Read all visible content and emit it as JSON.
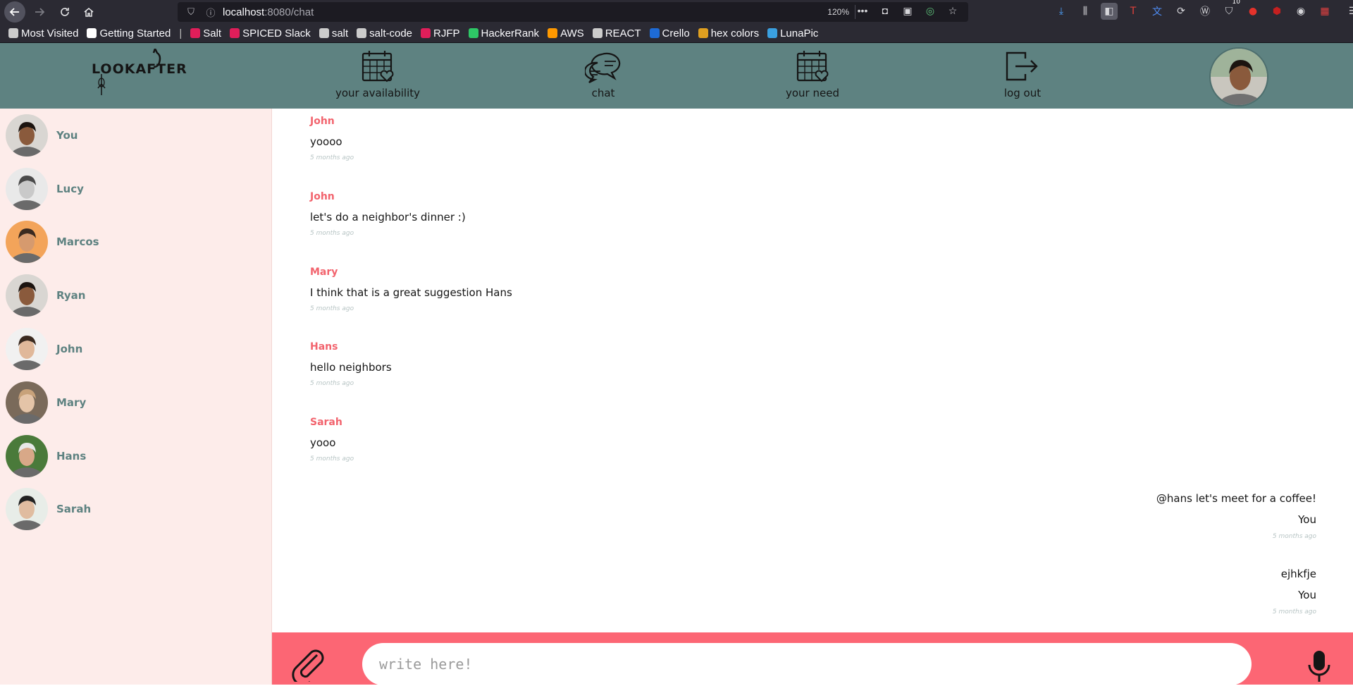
{
  "browser": {
    "url_host": "localhost",
    "url_path": ":8080/chat",
    "zoom": "120%",
    "extension_badge": "10"
  },
  "bookmarks": [
    {
      "label": "Most Visited",
      "icon": "gear-icon",
      "color": "#cccccc"
    },
    {
      "label": "Getting Started",
      "icon": "m-icon",
      "color": "#ffffff"
    },
    {
      "label": "Salt",
      "icon": "slack-icon",
      "color": "#e01e5a"
    },
    {
      "label": "SPICED Slack",
      "icon": "slack-icon",
      "color": "#e01e5a"
    },
    {
      "label": "salt",
      "icon": "github-icon",
      "color": "#cccccc"
    },
    {
      "label": "salt-code",
      "icon": "github-icon",
      "color": "#cccccc"
    },
    {
      "label": "RJFP",
      "icon": "slack-icon",
      "color": "#e01e5a"
    },
    {
      "label": "HackerRank",
      "icon": "hackerrank-icon",
      "color": "#2ec866"
    },
    {
      "label": "AWS",
      "icon": "aws-icon",
      "color": "#ff9900"
    },
    {
      "label": "REACT",
      "icon": "folder-icon",
      "color": "#cccccc"
    },
    {
      "label": "Crello",
      "icon": "crello-icon",
      "color": "#1e6bd6"
    },
    {
      "label": "hex colors",
      "icon": "color-wheel-icon",
      "color": "#e0a020"
    },
    {
      "label": "LunaPic",
      "icon": "lunapic-icon",
      "color": "#3aa0e0"
    }
  ],
  "header": {
    "logo_text": "LOOKAFTER",
    "nav": [
      {
        "label": "your availability",
        "icon": "calendar-heart-icon"
      },
      {
        "label": "chat",
        "icon": "chat-bubbles-icon"
      },
      {
        "label": "your need",
        "icon": "calendar-heart-icon"
      },
      {
        "label": "log out",
        "icon": "logout-icon"
      }
    ]
  },
  "contacts": [
    {
      "name": "You",
      "skin": "#8a5a3c",
      "hair": "#1c1410",
      "bg": "#d9d6d2"
    },
    {
      "name": "Lucy",
      "skin": "#c9c9c9",
      "hair": "#4a4a4a",
      "bg": "#e9e9e9"
    },
    {
      "name": "Marcos",
      "skin": "#d69a6e",
      "hair": "#3a2a20",
      "bg": "#f3a45a"
    },
    {
      "name": "Ryan",
      "skin": "#8a5a3c",
      "hair": "#1c1410",
      "bg": "#d9d6d2"
    },
    {
      "name": "John",
      "skin": "#e0b89a",
      "hair": "#3a2a20",
      "bg": "#f1f1f1"
    },
    {
      "name": "Mary",
      "skin": "#e4c4a8",
      "hair": "#c8a27a",
      "bg": "#7a6a5a"
    },
    {
      "name": "Hans",
      "skin": "#d8a888",
      "hair": "#e8e8e8",
      "bg": "#4a7a3a"
    },
    {
      "name": "Sarah",
      "skin": "#e0bca0",
      "hair": "#222222",
      "bg": "#e8ede8"
    }
  ],
  "messages": [
    {
      "author": "John",
      "text": "yoooo",
      "time": "5 months ago"
    },
    {
      "author": "John",
      "text": "let's do a neighbor's dinner :)",
      "time": "5 months ago"
    },
    {
      "author": "Mary",
      "text": "I think that is a great suggestion Hans",
      "time": "5 months ago"
    },
    {
      "author": "Hans",
      "text": "hello neighbors",
      "time": "5 months ago"
    },
    {
      "author": "Sarah",
      "text": "yooo",
      "time": "5 months ago"
    }
  ],
  "own_messages": [
    {
      "text": "@hans let's meet for a coffee!",
      "author": "You",
      "time": "5 months ago"
    },
    {
      "text": "ejhkfje",
      "author": "You",
      "time": "5 months ago"
    }
  ],
  "composer": {
    "placeholder": "write here!"
  },
  "colors": {
    "header_bg": "#5e8281",
    "sidebar_bg": "#fdecea",
    "accent": "#fc6674",
    "author_color": "#f2636d"
  }
}
